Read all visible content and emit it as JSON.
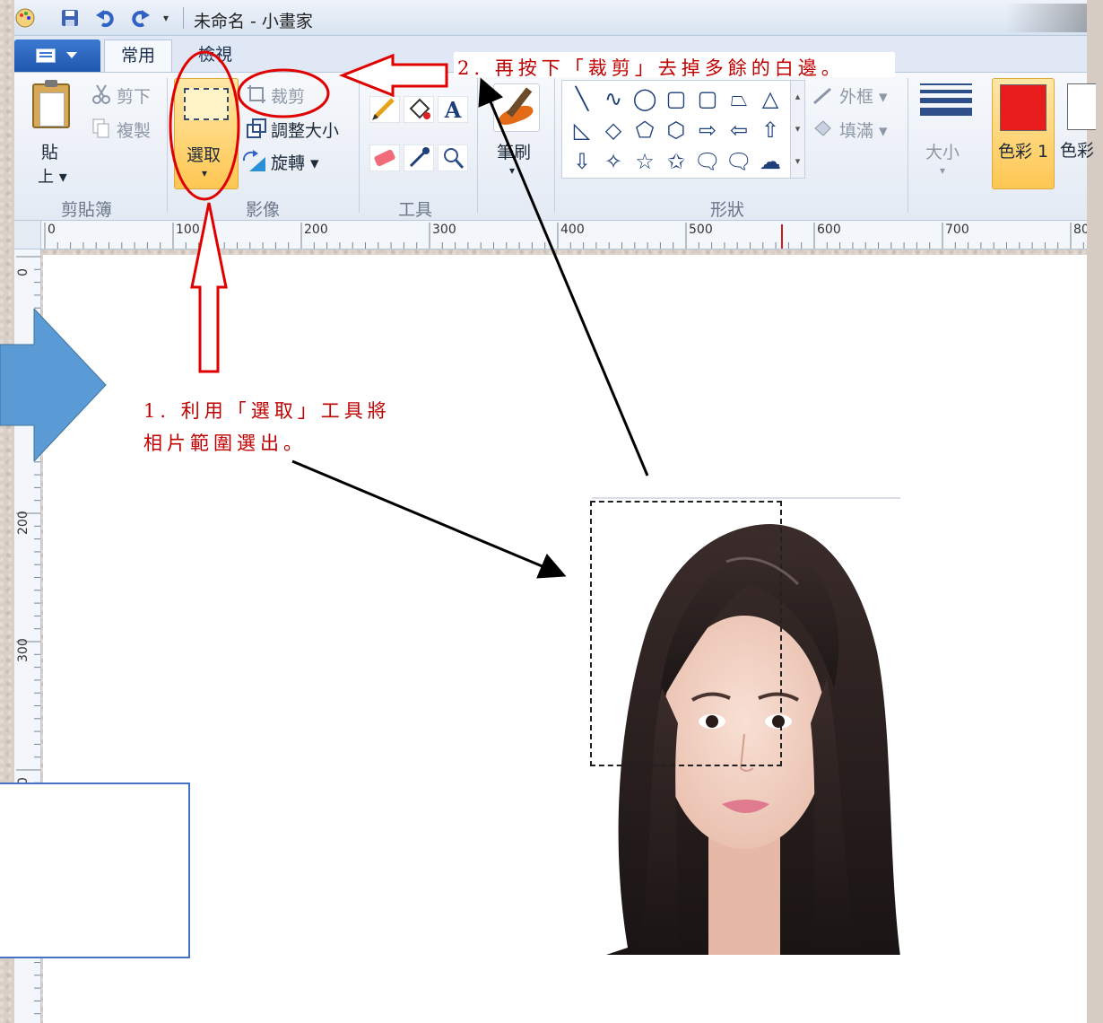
{
  "window": {
    "title": "未命名 - 小畫家",
    "qa_dropdown": "▾"
  },
  "tabs": [
    {
      "label": "常用"
    },
    {
      "label": "檢視"
    }
  ],
  "clipboard": {
    "paste_label_1": "貼",
    "paste_label_2": "上 ▾",
    "cut_label": "剪下",
    "copy_label": "複製",
    "group_label": "剪貼簿"
  },
  "image": {
    "select_label": "選取",
    "select_arrow": "▾",
    "crop_label": "裁剪",
    "resize_label": "調整大小",
    "rotate_label": "旋轉 ▾",
    "group_label": "影像"
  },
  "tools": {
    "group_label": "工具"
  },
  "brushes": {
    "label": "筆刷",
    "arrow": "▾"
  },
  "shapes": {
    "outline_label": "外框 ▾",
    "fill_label": "填滿 ▾",
    "group_label": "形狀",
    "gallery": [
      "╲",
      "∿",
      "◯",
      "▢",
      "▢",
      "⏢",
      "△",
      "◺",
      "◇",
      "⬠",
      "⬡",
      "⇨",
      "⇦",
      "⇧",
      "⇩",
      "✧",
      "☆",
      "✩",
      "🗨",
      "🗨",
      "☁"
    ]
  },
  "size": {
    "label": "大小",
    "arrow": "▾"
  },
  "colors": {
    "color1_label": "色彩 1",
    "color2_label": "色彩",
    "color1_value": "#e81c1c"
  },
  "ruler": {
    "h_labels": [
      "0",
      "100",
      "200",
      "300",
      "400",
      "500",
      "600",
      "700",
      "80"
    ],
    "v_labels": [
      "0",
      "200",
      "300",
      "00"
    ]
  },
  "annotations": {
    "step2": "2. 再按下「裁剪」去掉多餘的白邊。",
    "step1_line1": "1. 利用「選取」工具將",
    "step1_line2": "相片範圍選出。"
  },
  "style": {
    "annotation_color": "#c00000",
    "arrow_blue": "#5b9bd5",
    "box_border": "#4472c4"
  }
}
